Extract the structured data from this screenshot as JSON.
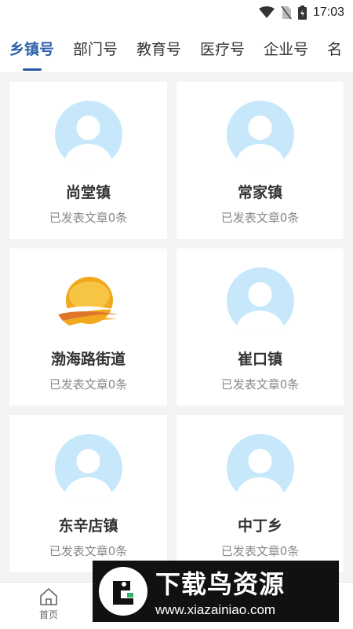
{
  "status_bar": {
    "time": "17:03"
  },
  "tabs": [
    {
      "label": "乡镇号",
      "active": true
    },
    {
      "label": "部门号",
      "active": false
    },
    {
      "label": "教育号",
      "active": false
    },
    {
      "label": "医疗号",
      "active": false
    },
    {
      "label": "企业号",
      "active": false
    },
    {
      "label": "名",
      "active": false
    }
  ],
  "cards": [
    {
      "name": "尚堂镇",
      "count": "已发表文章0条",
      "avatar": "default-avatar-icon"
    },
    {
      "name": "常家镇",
      "count": "已发表文章0条",
      "avatar": "default-avatar-icon"
    },
    {
      "name": "渤海路街道",
      "count": "已发表文章0条",
      "avatar": "sun-logo-icon"
    },
    {
      "name": "崔口镇",
      "count": "已发表文章0条",
      "avatar": "default-avatar-icon"
    },
    {
      "name": "东辛店镇",
      "count": "已发表文章0条",
      "avatar": "default-avatar-icon"
    },
    {
      "name": "中丁乡",
      "count": "已发表文章0条",
      "avatar": "default-avatar-icon"
    }
  ],
  "bottom_nav": {
    "home_label": "首页"
  },
  "watermark": {
    "title": "下载鸟资源",
    "url": "www.xiazainiao.com"
  },
  "colors": {
    "accent": "#2f62ad",
    "avatar_bg": "#c7e8fb",
    "page_bg": "#f3f3f3"
  }
}
